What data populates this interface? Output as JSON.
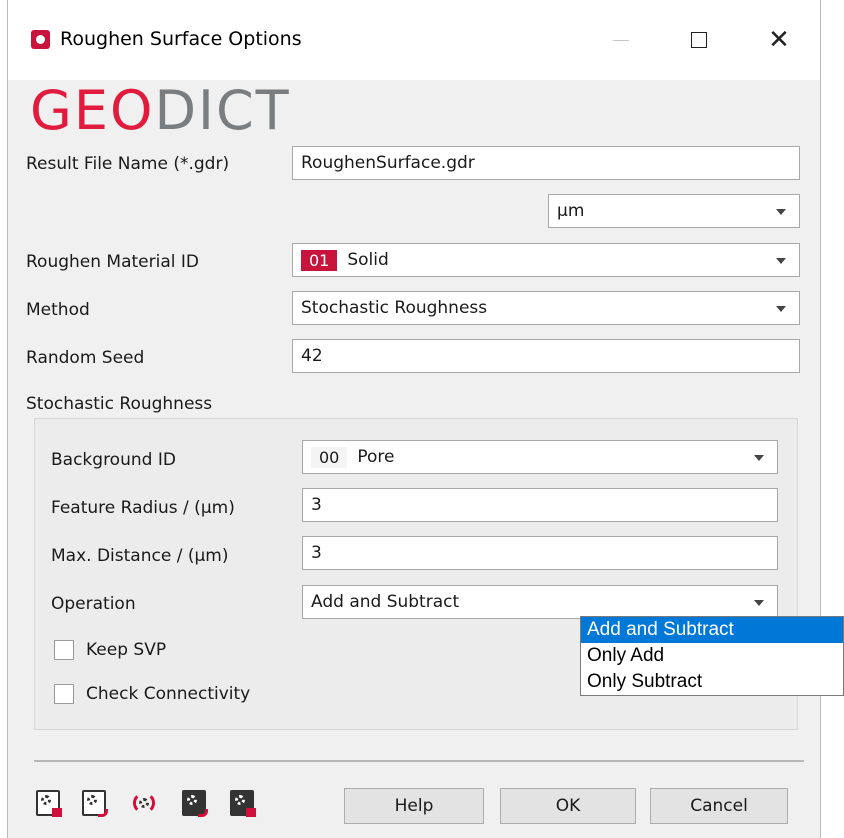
{
  "window": {
    "title": "Roughen Surface Options",
    "close_glyph": "✕"
  },
  "logo": {
    "part1": "GEO",
    "part2": "DICT"
  },
  "form": {
    "result_file_label": "Result File Name (*.gdr)",
    "result_file_value": "RoughenSurface.gdr",
    "unit_value": "µm",
    "material_label": "Roughen Material ID",
    "material_id": "01",
    "material_name": "Solid",
    "method_label": "Method",
    "method_value": "Stochastic Roughness",
    "seed_label": "Random Seed",
    "seed_value": "42"
  },
  "group": {
    "title": "Stochastic Roughness",
    "background_label": "Background ID",
    "background_id": "00",
    "background_name": "Pore",
    "radius_label": "Feature Radius / (µm)",
    "radius_value": "3",
    "distance_label": "Max. Distance / (µm)",
    "distance_value": "3",
    "operation_label": "Operation",
    "operation_value": "Add and Subtract",
    "keep_svp_label": "Keep SVP",
    "keep_svp_checked": false,
    "connectivity_label": "Check Connectivity",
    "connectivity_checked": false
  },
  "operation_options": [
    "Add and Subtract",
    "Only Add",
    "Only Subtract"
  ],
  "operation_selected_index": 0,
  "buttons": {
    "help": "Help",
    "ok": "OK",
    "cancel": "Cancel"
  },
  "toolbar_icons": [
    "gear-lock-icon",
    "gear-arrow-icon",
    "gear-refresh-icon",
    "dark-gear-arrow-icon",
    "dark-gear-lock-icon"
  ],
  "colors": {
    "brand_red": "#c8143c",
    "logo_gray": "#7a7d80",
    "selection_blue": "#0078d7",
    "dialog_bg": "#f0f0f0"
  }
}
